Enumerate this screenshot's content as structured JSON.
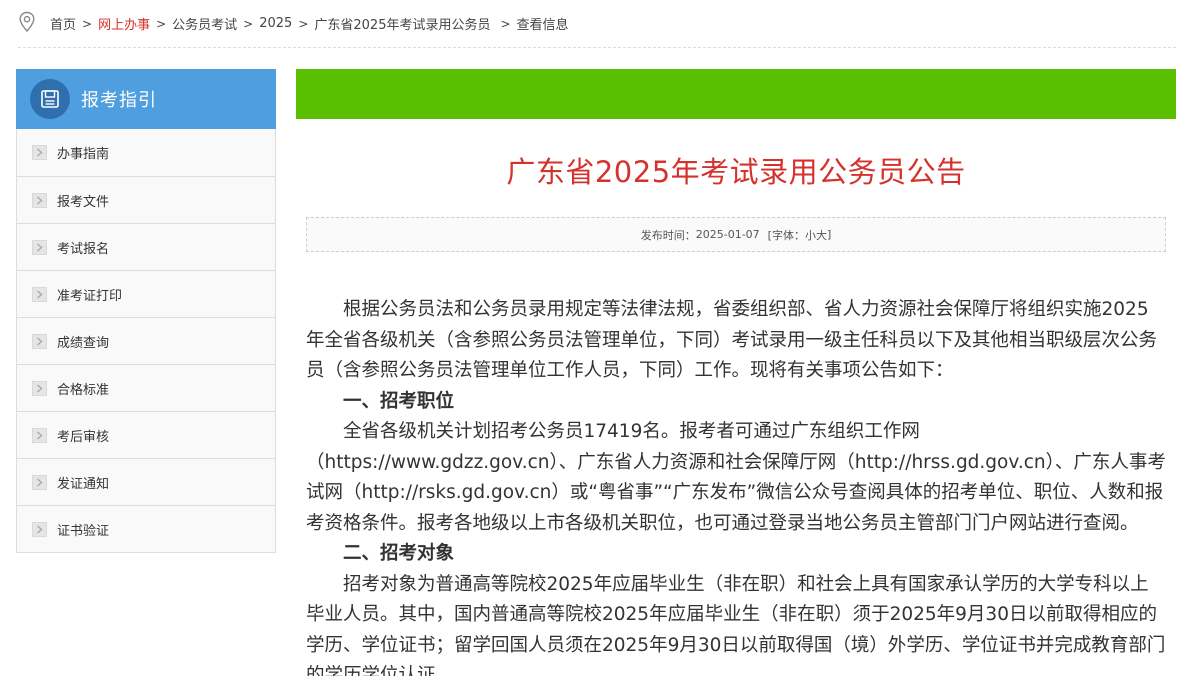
{
  "breadcrumb": {
    "items": [
      {
        "label": "首页",
        "active": false
      },
      {
        "label": "网上办事",
        "active": true
      },
      {
        "label": "公务员考试",
        "active": false
      },
      {
        "label": "2025",
        "active": false
      },
      {
        "label": "广东省2025年考试录用公务员",
        "active": false
      },
      {
        "label": "查看信息",
        "active": false
      }
    ],
    "separator": ">"
  },
  "sidebar": {
    "title": "报考指引",
    "items": [
      {
        "label": "办事指南"
      },
      {
        "label": "报考文件"
      },
      {
        "label": "考试报名"
      },
      {
        "label": "准考证打印"
      },
      {
        "label": "成绩查询"
      },
      {
        "label": "合格标准"
      },
      {
        "label": "考后审核"
      },
      {
        "label": "发证通知"
      },
      {
        "label": "证书验证"
      }
    ]
  },
  "article": {
    "title": "广东省2025年考试录用公务员公告",
    "publish_label": "发布时间：",
    "publish_date": "2025-01-07",
    "font_prefix": "[字体：",
    "font_small": "小",
    "font_large": "大",
    "font_suffix": "]",
    "paragraphs": [
      {
        "text": "根据公务员法和公务员录用规定等法律法规，省委组织部、省人力资源社会保障厅将组织实施2025年全省各级机关（含参照公务员法管理单位，下同）考试录用一级主任科员以下及其他相当职级层次公务员（含参照公务员法管理单位工作人员，下同）工作。现将有关事项公告如下：",
        "heading": false
      },
      {
        "text": "一、招考职位",
        "heading": true
      },
      {
        "text": "全省各级机关计划招考公务员17419名。报考者可通过广东组织工作网（https://www.gdzz.gov.cn）、广东省人力资源和社会保障厅网（http://hrss.gd.gov.cn）、广东人事考试网（http://rsks.gd.gov.cn）或“粤省事”“广东发布”微信公众号查阅具体的招考单位、职位、人数和报考资格条件。报考各地级以上市各级机关职位，也可通过登录当地公务员主管部门门户网站进行查阅。",
        "heading": false
      },
      {
        "text": "二、招考对象",
        "heading": true
      },
      {
        "text": "招考对象为普通高等院校2025年应届毕业生（非在职）和社会上具有国家承认学历的大学专科以上毕业人员。其中，国内普通高等院校2025年应届毕业生（非在职）须于2025年9月30日以前取得相应的学历、学位证书；留学回国人员须在2025年9月30日以前取得国（境）外学历、学位证书并完成教育部门的学历学位认证。",
        "heading": false
      }
    ]
  },
  "colors": {
    "accent_red": "#d6322c",
    "sidebar_blue": "#4f9fe0",
    "banner_green": "#5abf00"
  }
}
